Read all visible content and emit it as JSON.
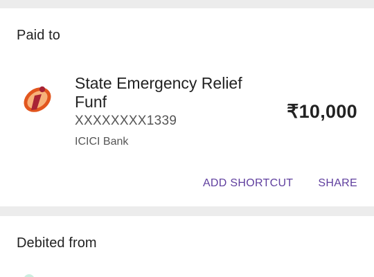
{
  "paid_section": {
    "title": "Paid to",
    "payee": {
      "name": "State Emergency Relief Funf",
      "account": "XXXXXXXX1339",
      "bank": "ICICI Bank",
      "logo_icon": "icici-bank-logo-icon"
    },
    "amount": "₹10,000",
    "actions": {
      "add_shortcut_label": "ADD SHORTCUT",
      "share_label": "SHARE"
    }
  },
  "debited_section": {
    "title": "Debited from"
  },
  "colors": {
    "accent": "#5f3e9e",
    "background": "#ececec",
    "card": "#ffffff",
    "logo_orange": "#e2561e",
    "logo_maroon": "#a82335"
  }
}
